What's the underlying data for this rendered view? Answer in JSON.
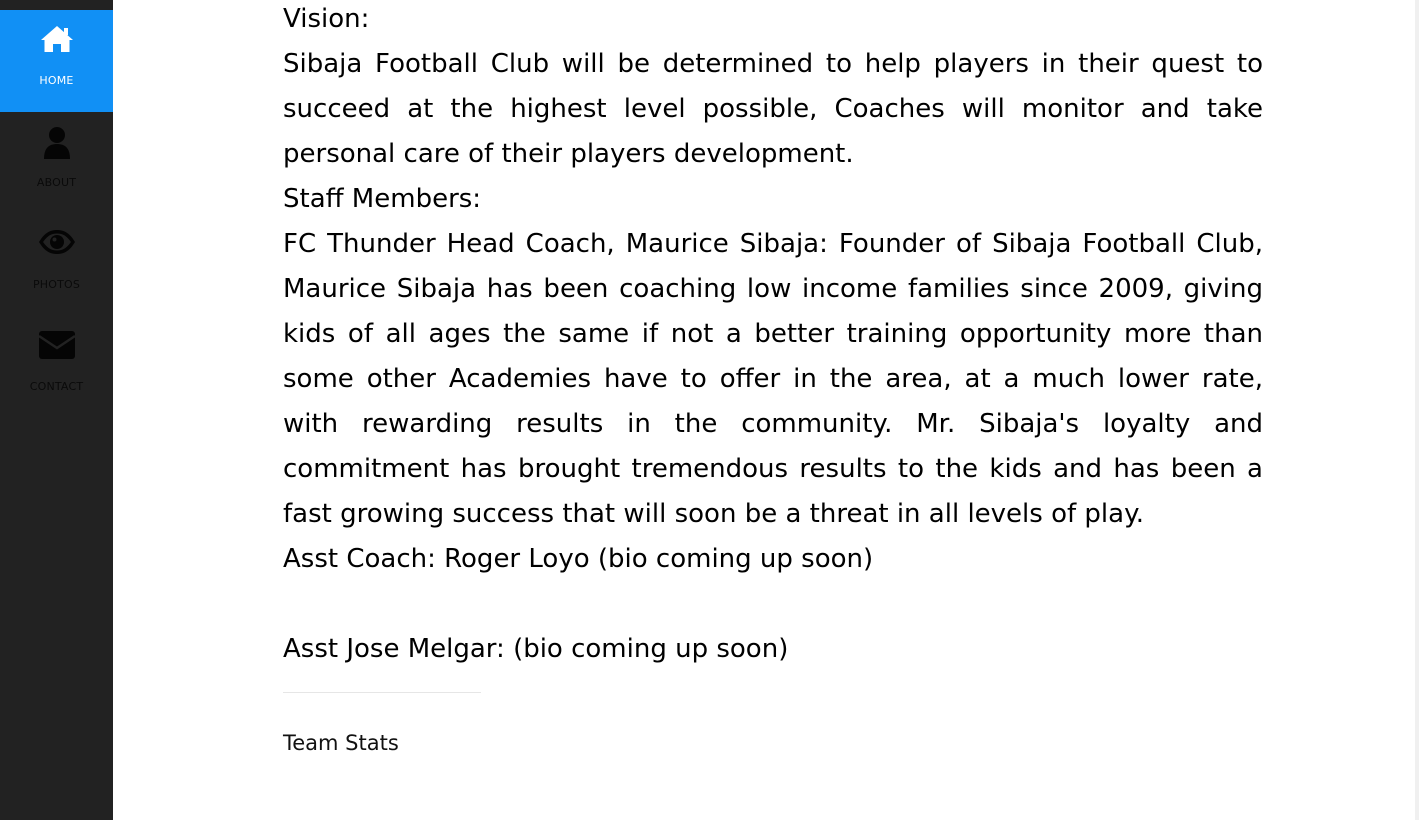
{
  "sidebar": {
    "items": [
      {
        "label": "HOME",
        "icon": "home-icon",
        "active": true
      },
      {
        "label": "ABOUT",
        "icon": "user-icon",
        "active": false
      },
      {
        "label": "PHOTOS",
        "icon": "eye-icon",
        "active": false
      },
      {
        "label": "CONTACT",
        "icon": "envelope-icon",
        "active": false
      }
    ],
    "background": "#222222",
    "active_color": "#1190f5"
  },
  "content": {
    "vision_heading": "Vision:",
    "vision_text": "Sibaja Football Club will be determined to help players in their quest to succeed at the highest level possible, Coaches will monitor and take personal care of their players development.",
    "staff_heading": "Staff Members:",
    "head_coach_text": "FC Thunder Head Coach, Maurice Sibaja: Founder of Sibaja Football Club, Maurice Sibaja has been coaching low income families since 2009, giving kids of all ages the same if not a better training opportunity more than some other Academies have to offer in the area, at a much lower rate, with rewarding results in the community. Mr. Sibaja's loyalty and commitment has brought tremendous results to the kids and has been a fast growing success that will soon be a threat in all levels of play.",
    "asst_coach_1": "Asst Coach: Roger Loyo (bio coming up soon)",
    "asst_coach_2": "Asst Jose Melgar: (bio coming up soon)",
    "team_stats_heading": "Team Stats"
  }
}
